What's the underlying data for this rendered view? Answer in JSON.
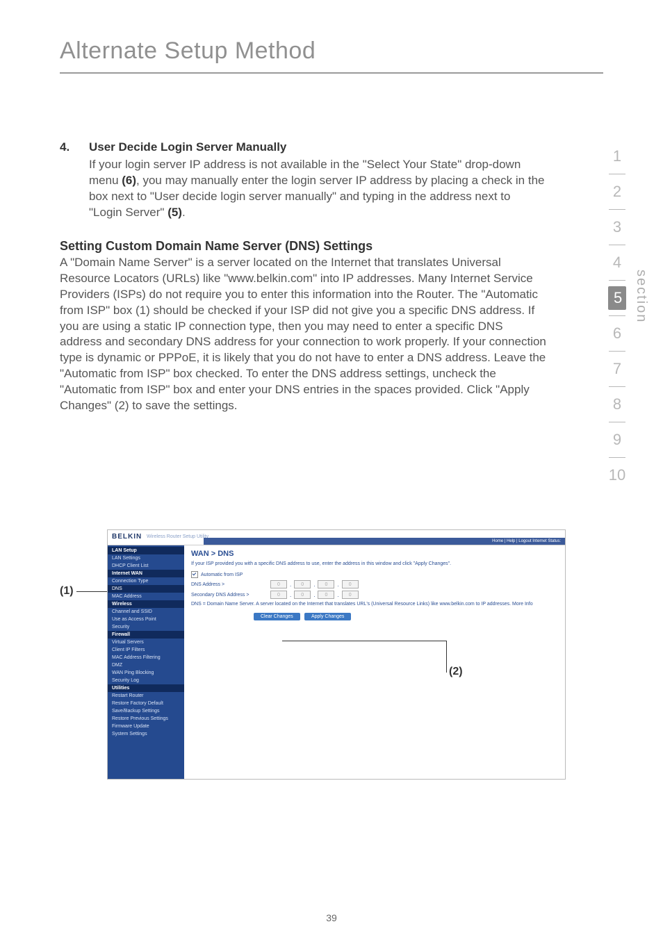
{
  "page_title": "Alternate Setup Method",
  "page_number": "39",
  "section_label": "section",
  "section_nav": {
    "items": [
      "1",
      "2",
      "3",
      "4",
      "5",
      "6",
      "7",
      "8",
      "9",
      "10"
    ],
    "active": "5"
  },
  "block4": {
    "number": "4.",
    "heading": "User Decide Login Server Manually",
    "para_parts": [
      "If your login server IP address is not available in the \"Select Your State\" drop-down menu ",
      "(6)",
      ", you may manually enter the login server IP address by placing a check in the box next to \"User decide login server manually\" and typing in the address next to \"Login Server\" ",
      "(5)",
      "."
    ]
  },
  "dns_section": {
    "heading": "Setting Custom Domain Name Server (DNS) Settings",
    "para": "A \"Domain Name Server\" is a server located on the Internet that translates Universal Resource Locators (URLs) like \"www.belkin.com\" into IP addresses. Many Internet Service Providers (ISPs) do not require you to enter this information into the Router. The \"Automatic from ISP\" box (1) should be checked if your ISP did not give you a specific DNS address. If you are using a static IP connection type, then you may need to enter a specific DNS address and secondary DNS address for your connection to work properly. If your connection type is dynamic or PPPoE, it is likely that you do not have to enter a DNS address. Leave the \"Automatic from ISP\" box checked. To enter the DNS address settings, uncheck the \"Automatic from ISP\" box and enter your DNS entries in the spaces provided. Click \"Apply Changes\" (2) to save the settings."
  },
  "callouts": {
    "c1": "(1)",
    "c2": "(2)"
  },
  "router": {
    "logo": "BELKIN",
    "logo_sub": "Wireless Router Setup Utility",
    "topbar": "Home | Help | Logout   Internet Status:",
    "breadcrumb": "WAN > DNS",
    "intro": "If your ISP provided you with a specific DNS address to use, enter the address in this window and click \"Apply Changes\".",
    "auto_label": "Automatic from ISP",
    "dns_label": "DNS Address >",
    "dns2_label": "Secondary DNS Address >",
    "footer_note": "DNS = Domain Name Server. A server located on the Internet that translates URL's (Universal Resource Links) like www.belkin.com to IP addresses. More Info",
    "btn_clear": "Clear Changes",
    "btn_apply": "Apply Changes",
    "ip_placeholder": "0",
    "sidebar": [
      {
        "type": "cat",
        "label": "LAN Setup"
      },
      {
        "type": "item",
        "label": "LAN Settings"
      },
      {
        "type": "item",
        "label": "DHCP Client List"
      },
      {
        "type": "cat",
        "label": "Internet WAN"
      },
      {
        "type": "item",
        "label": "Connection Type"
      },
      {
        "type": "item",
        "label": "DNS",
        "active": true
      },
      {
        "type": "item",
        "label": "MAC Address"
      },
      {
        "type": "cat",
        "label": "Wireless"
      },
      {
        "type": "item",
        "label": "Channel and SSID"
      },
      {
        "type": "item",
        "label": "Use as Access Point"
      },
      {
        "type": "item",
        "label": "Security"
      },
      {
        "type": "cat",
        "label": "Firewall"
      },
      {
        "type": "item",
        "label": "Virtual Servers"
      },
      {
        "type": "item",
        "label": "Client IP Filters"
      },
      {
        "type": "item",
        "label": "MAC Address Filtering"
      },
      {
        "type": "item",
        "label": "DMZ"
      },
      {
        "type": "item",
        "label": "WAN Ping Blocking"
      },
      {
        "type": "item",
        "label": "Security Log"
      },
      {
        "type": "cat",
        "label": "Utilities"
      },
      {
        "type": "item",
        "label": "Restart Router"
      },
      {
        "type": "item",
        "label": "Restore Factory Default"
      },
      {
        "type": "item",
        "label": "Save/Backup Settings"
      },
      {
        "type": "item",
        "label": "Restore Previous Settings"
      },
      {
        "type": "item",
        "label": "Firmware Update"
      },
      {
        "type": "item",
        "label": "System Settings"
      }
    ]
  }
}
